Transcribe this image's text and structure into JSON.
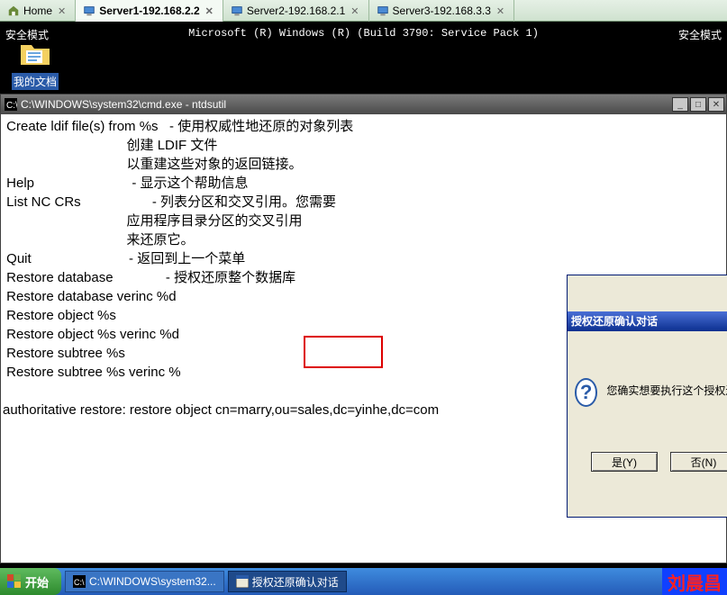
{
  "tabs": {
    "home": "Home",
    "s1": "Server1-192.168.2.2",
    "s2": "Server2-192.168.2.1",
    "s3": "Server3-192.168.3.3"
  },
  "safemode": "安全模式",
  "build": "Microsoft (R) Windows (R) (Build 3790: Service Pack 1)",
  "desktop": {
    "mydocs": "我的文档"
  },
  "cmd": {
    "title": "C:\\WINDOWS\\system32\\cmd.exe - ntdsutil",
    "body": " Create ldif file(s) from %s   - 使用权威性地还原的对象列表\n                                 创建 LDIF 文件\n                                 以重建这些对象的返回链接。\n Help                          - 显示这个帮助信息\n List NC CRs                   - 列表分区和交叉引用。您需要\n                                 应用程序目录分区的交叉引用\n                                 来还原它。\n Quit                          - 返回到上一个菜单\n Restore database              - 授权还原整个数据库\n Restore database verinc %d \n Restore object %s          \n Restore object %s verinc %d\n Restore subtree %s         \n Restore subtree %s verinc %\n\nauthoritative restore: restore object cn=marry,ou=sales,dc=yinhe,dc=com"
  },
  "dialog": {
    "title": "授权还原确认对话",
    "text": "您确实想要执行这个授权还原?",
    "yes": "是(Y)",
    "no": "否(N)"
  },
  "taskbar": {
    "start": "开始",
    "task1": "C:\\WINDOWS\\system32...",
    "task2": "授权还原确认对话"
  },
  "watermark": "刘晨昌"
}
